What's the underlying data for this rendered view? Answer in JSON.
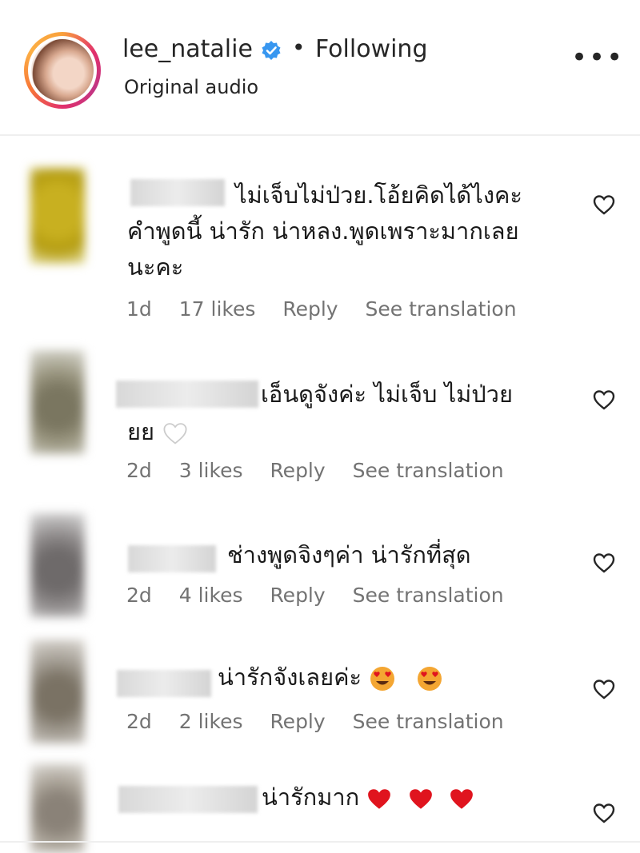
{
  "header": {
    "username": "lee_natalie",
    "separator": "•",
    "follow_status": "Following",
    "audio_label": "Original audio",
    "more_label": "•••",
    "verified_color": "#3897f0"
  },
  "comments": [
    {
      "text_line1": "ไม่เจ็บไม่ป่วย.โอ้ยคิดได้ไงคะ",
      "text_line2": "คำพูดนี้ น่ารัก น่าหลง.พูดเพราะมากเลย",
      "text_line3": "นะคะ",
      "time": "1d",
      "likes": "17 likes",
      "reply": "Reply",
      "translate": "See translation"
    },
    {
      "text_line1": "เอ็นดูจังค่ะ ไม่เจ็บ ไม่ป่วย",
      "text_line2": "ยย",
      "time": "2d",
      "likes": "3 likes",
      "reply": "Reply",
      "translate": "See translation"
    },
    {
      "text_line1": "ช่างพูดจิงๆค่า น่ารักที่สุด",
      "time": "2d",
      "likes": "4 likes",
      "reply": "Reply",
      "translate": "See translation"
    },
    {
      "text_line1": "น่ารักจังเลยค่ะ",
      "time": "2d",
      "likes": "2 likes",
      "reply": "Reply",
      "translate": "See translation"
    },
    {
      "text_line1": "น่ารักมาก"
    }
  ],
  "colors": {
    "text": "#262626",
    "meta": "#737373",
    "heart_red": "#e0141e"
  },
  "icons": [
    "verified-badge-icon",
    "more-options-icon",
    "heart-outline-icon",
    "smiling-face-with-heart-eyes-icon",
    "red-heart-icon",
    "white-heart-icon"
  ]
}
